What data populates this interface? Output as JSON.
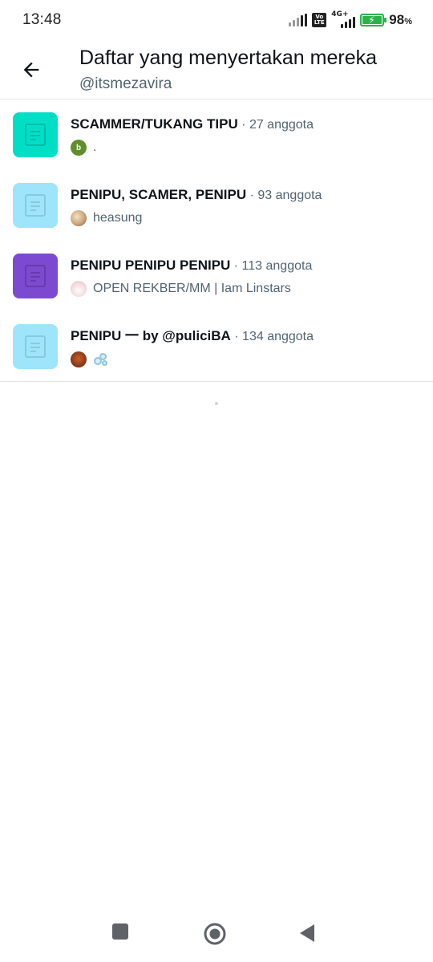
{
  "status_bar": {
    "time": "13:48",
    "volte": "Vo LTE",
    "network": "4G+",
    "battery_percent": "98",
    "battery_unit": "%",
    "battery_level": 0.98
  },
  "header": {
    "title": "Daftar yang menyertakan mereka",
    "subtitle": "@itsmezavira"
  },
  "lists": [
    {
      "name": "SCAMMER/TUKANG TIPU",
      "members": " · 27 anggota",
      "owner_name": ".",
      "owner_avatar_letter": "b",
      "thumb_color": "#00dec6"
    },
    {
      "name": "PENIPU, SCAMER, PENIPU",
      "members": " · 93 anggota",
      "owner_name": "heasung",
      "thumb_color": "#9ee5fb"
    },
    {
      "name": "PENIPU PENIPU PENIPU",
      "members": " · 113 anggota",
      "owner_name": "OPEN REKBER/MM | Iam Linstars",
      "thumb_color": "#7c4ad1"
    },
    {
      "name": "PENIPU 一 by @puliciBA",
      "members": " · 134 anggota",
      "owner_name": "",
      "thumb_color": "#9ee5fb"
    }
  ],
  "colors": {
    "text_primary": "#0f1419",
    "text_secondary": "#536471",
    "divider": "#dfe3e6"
  }
}
